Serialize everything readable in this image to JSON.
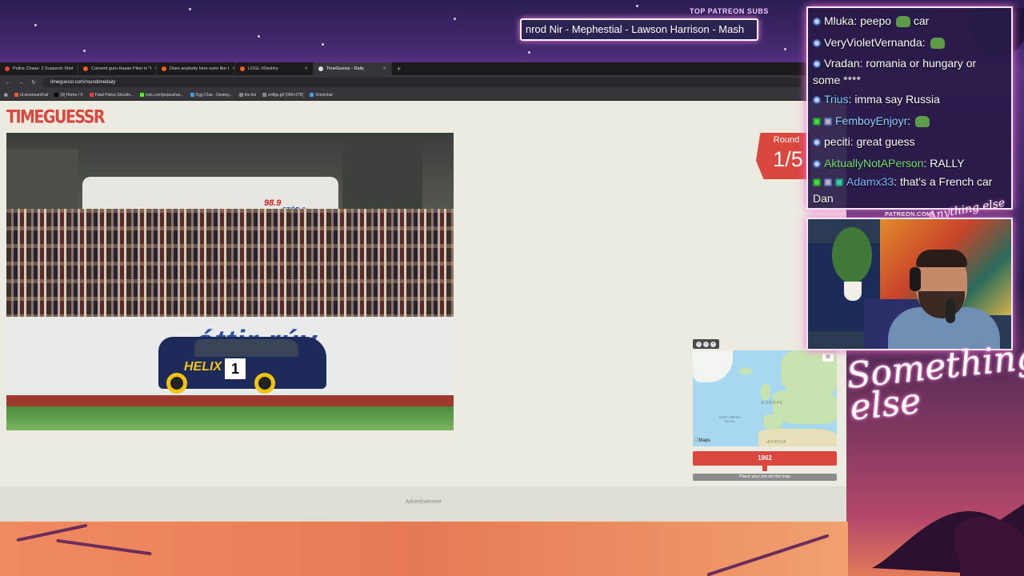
{
  "overlay": {
    "banner_label": "TOP PATREON SUBS",
    "banner_text": "nrod Nir - Mephestial - Lawson Harrison - Mash",
    "patreon_url": "PATREON.COM/",
    "brand_script": "Something else",
    "brand_script_top": "Anything else"
  },
  "browser": {
    "tabs": [
      {
        "label": "Police Chase: 2 Suspects Shot",
        "active": false
      },
      {
        "label": "Convent guru Hasan Piker is \"t",
        "active": false
      },
      {
        "label": "Does anybody here even like t",
        "active": false
      },
      {
        "label": "LOGL r/Destiny",
        "active": false
      },
      {
        "label": "TimeGuessr - Daily",
        "active": true
      }
    ],
    "new_tab": "+",
    "url": "timeguessr.com/roundonedaily",
    "bookmarks": [
      "r/LivestreamFail",
      "(9) Home / X",
      "Fatal Police Shootin...",
      "kick.com/popout/an...",
      "Dgg Chat - Destiny...",
      "the list",
      "enfigs.gif (399×278)",
      "Omnichat"
    ]
  },
  "page": {
    "logo": "TIMEGUESSR",
    "round_label": "Round",
    "round_value": "1/5",
    "photo_signs": {
      "banner": "óttir rúv",
      "car_sponsor": "HELIX",
      "car_number": "1",
      "rv_radio": "98.9",
      "rv_text": "STÖÐ 2"
    },
    "map": {
      "label_ocean": "North Atlantic Ocean",
      "label_europe": "EUROPE",
      "label_africa": "AFRICA",
      "brand": "Maps"
    },
    "year_value": "1962",
    "slider_level": 0.5,
    "place_pin_text": "Place your pin on the map",
    "ad_label": "Advertisement"
  },
  "chat": {
    "messages": [
      {
        "user": "Mluka",
        "text": "peepo",
        "tail": "car",
        "user_color": "#ffffff",
        "emote": true
      },
      {
        "user": "VeryVioletVernanda",
        "text": "",
        "tail": "",
        "user_color": "#ffffff",
        "emote": true
      },
      {
        "user": "Vradan",
        "text": "romania or hungary or some ****",
        "tail": "",
        "user_color": "#ffffff",
        "emote": false
      },
      {
        "user": "Trius",
        "text": "imma say Russia",
        "tail": "",
        "user_color": "#7fd0ff",
        "emote": false
      },
      {
        "user": "FemboyEnjoyr",
        "text": "",
        "tail": "",
        "user_color": "#8fd2ff",
        "emote": true
      },
      {
        "user": "peciti",
        "text": "great guess",
        "tail": "",
        "user_color": "#ffffff",
        "emote": false
      },
      {
        "user": "AktuallyNotAPerson",
        "text": "RALLY",
        "tail": "",
        "user_color": "#6fe36f",
        "emote": false
      },
      {
        "user": "Adamx33",
        "text": "that's a French car Dan",
        "tail": "",
        "user_color": "#7fb8ff",
        "emote": false
      }
    ]
  },
  "colors": {
    "accent_red": "#d9473f",
    "chat_border": "#f3e8ff",
    "page_bg": "#edeae0"
  }
}
